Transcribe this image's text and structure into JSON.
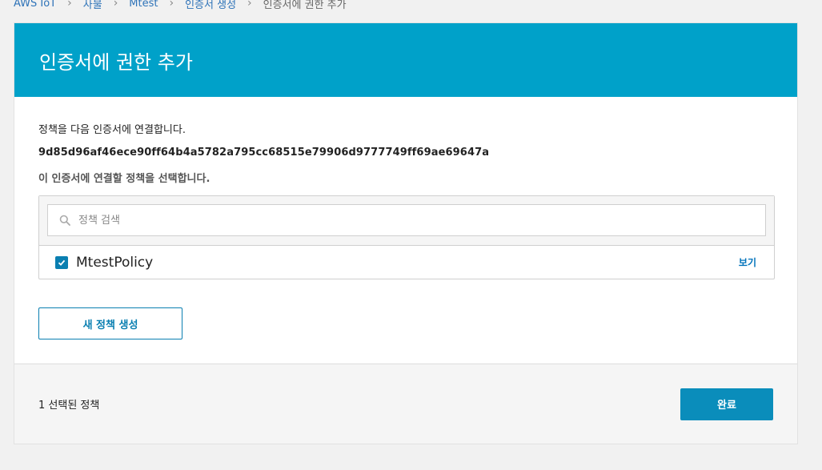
{
  "breadcrumb": {
    "items": [
      "AWS IoT",
      "사물",
      "Mtest",
      "인증서 생성"
    ],
    "current": "인증서에 권한 추가"
  },
  "header": {
    "title": "인증서에 권한 추가"
  },
  "body": {
    "lead": "정책을 다음 인증서에 연결합니다.",
    "cert_id": "9d85d96af46ece90ff64b4a5782a795cc68515e79906d9777749ff69ae69647a",
    "sub": "이 인증서에 연결할 정책을 선택합니다."
  },
  "search": {
    "placeholder": "정책 검색",
    "icon": "search-icon"
  },
  "policies": [
    {
      "name": "MtestPolicy",
      "checked": true,
      "view_label": "보기"
    }
  ],
  "create_button": {
    "label": "새 정책 생성"
  },
  "footer": {
    "selected_count": "1 선택된 정책",
    "done_label": "완료"
  },
  "colors": {
    "header": "#00a1c9",
    "accent": "#0a7fb1",
    "primary_button": "#0a8dbb"
  }
}
